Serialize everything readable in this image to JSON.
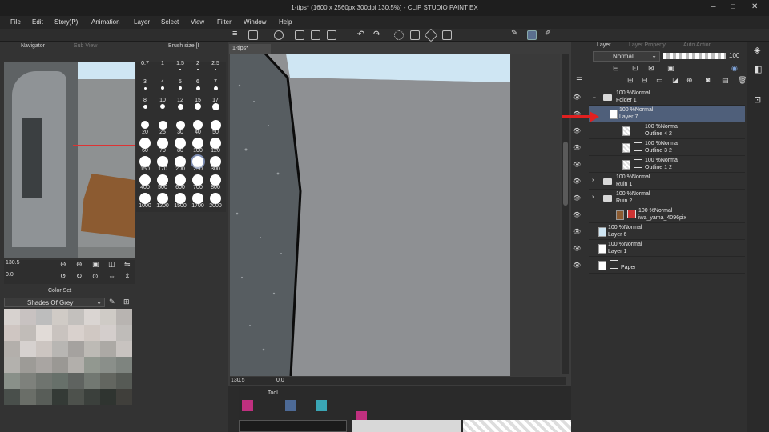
{
  "titlebar": {
    "title": "1-tips* (1600 x 2560px 300dpi 130.5%) - CLIP STUDIO PAINT EX"
  },
  "menu": [
    "File",
    "Edit",
    "Story(P)",
    "Animation",
    "Layer",
    "Select",
    "View",
    "Filter",
    "Window",
    "Help"
  ],
  "left_tabs": {
    "navigator": "Navigator",
    "sub_view": "Sub View",
    "brush_size": "Brush size [I"
  },
  "navigator": {
    "zoom": "130.5",
    "rotation": "0.0"
  },
  "brush_sizes": [
    "0.7",
    "1",
    "1.5",
    "2",
    "2.5",
    "3",
    "4",
    "5",
    "6",
    "7",
    "8",
    "10",
    "12",
    "15",
    "17",
    "20",
    "25",
    "30",
    "40",
    "50",
    "60",
    "70",
    "80",
    "100",
    "120",
    "150",
    "170",
    "200",
    "250",
    "300",
    "400",
    "500",
    "600",
    "700",
    "800",
    "1000",
    "1200",
    "1500",
    "1700",
    "2000"
  ],
  "color_set": {
    "tab": "Color Set",
    "palette_name": "Shades Of Grey",
    "swatches": [
      "#d7d2cf",
      "#c8c2c1",
      "#bdbdbd",
      "#d0cbc6",
      "#c3c0bd",
      "#dad5d2",
      "#cfcbc6",
      "#b8b4b1",
      "#cfc6c2",
      "#c1bcb8",
      "#e1dbd7",
      "#c9c3bf",
      "#d9d1cd",
      "#d0c8c3",
      "#d4cecc",
      "#bfbcb9",
      "#b3afab",
      "#d6d1cf",
      "#ccc5c1",
      "#b8b6b3",
      "#a5a29f",
      "#bdbab5",
      "#aca9a5",
      "#c8c3c0",
      "#b3b1ad",
      "#9d9b97",
      "#a9a5a2",
      "#9a9894",
      "#b2afab",
      "#929890",
      "#8a8f8a",
      "#7e847f",
      "#899089",
      "#7e817c",
      "#6f746f",
      "#67706a",
      "#5f6360",
      "#727872",
      "#636660",
      "#565a55",
      "#494f4b",
      "#6a6e68",
      "#585d58",
      "#343a36",
      "#4d514c",
      "#3b403c",
      "#2f3430",
      "#403f3b"
    ]
  },
  "canvas": {
    "tab": "1-tips*",
    "zoom": "130.5",
    "rotation": "0.0"
  },
  "bottom": {
    "tool_tab": "Tool"
  },
  "layer_panel": {
    "tabs": [
      "Layer",
      "Layer Property",
      "Auto Action"
    ],
    "blend_mode": "Normal",
    "opacity": "100",
    "layers": [
      {
        "opacity": "100 %Normal",
        "name": "Folder 1",
        "type": "folder",
        "selected": false
      },
      {
        "opacity": "100 %Normal",
        "name": "Layer 7",
        "type": "raster",
        "selected": true
      },
      {
        "opacity": "100 %Normal",
        "name": "Outline 4 2",
        "type": "vector",
        "selected": false
      },
      {
        "opacity": "100 %Normal",
        "name": "Outline 3 2",
        "type": "vector",
        "selected": false
      },
      {
        "opacity": "100 %Normal",
        "name": "Outline 1 2",
        "type": "vector",
        "selected": false
      },
      {
        "opacity": "100 %Normal",
        "name": "Ruin 1",
        "type": "folder",
        "selected": false
      },
      {
        "opacity": "100 %Normal",
        "name": "Ruin 2",
        "type": "folder",
        "selected": false
      },
      {
        "opacity": "100 %Normal",
        "name": "iwa_yama_4096pix",
        "type": "image",
        "selected": false
      },
      {
        "opacity": "100 %Normal",
        "name": "Layer 6",
        "type": "raster",
        "selected": false
      },
      {
        "opacity": "100 %Normal",
        "name": "Layer 1",
        "type": "raster",
        "selected": false
      },
      {
        "opacity": "",
        "name": "Paper",
        "type": "paper",
        "selected": false
      }
    ]
  },
  "colors": {
    "accent_red": "#e02020",
    "selection": "#4f5f7a",
    "sky": "#cfe6f3"
  }
}
